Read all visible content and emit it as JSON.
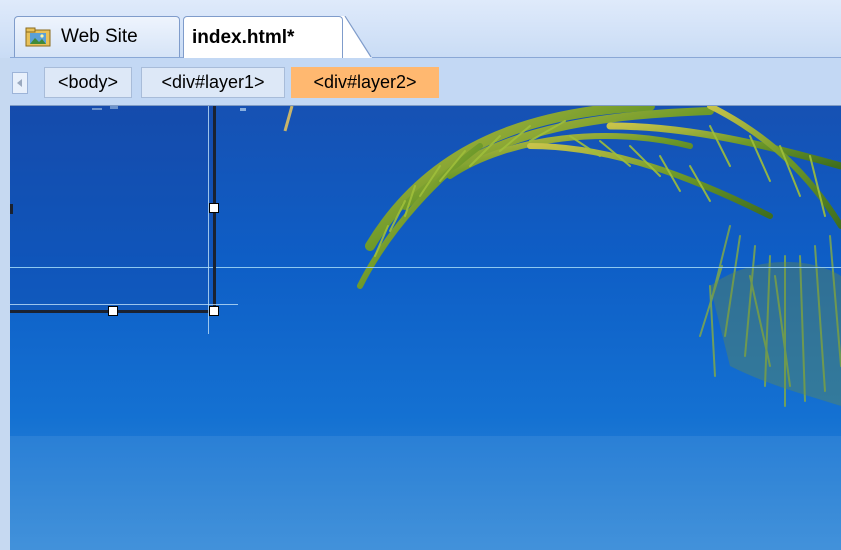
{
  "tabs": [
    {
      "label": "Web Site",
      "active": false,
      "icon": "folder-icon"
    },
    {
      "label": "index.html*",
      "active": true
    }
  ],
  "breadcrumb": {
    "scroll_icon": "scroll-left-icon",
    "items": [
      {
        "label": "<body>",
        "selected": false
      },
      {
        "label": "<div#layer1>",
        "selected": false
      },
      {
        "label": "<div#layer2>",
        "selected": true
      }
    ]
  },
  "colors": {
    "selected_crumb": "#ffb870",
    "sky_top": "#1757b8",
    "sky_bottom": "#3b8fd9",
    "guide_line": "#8ec8f0"
  }
}
